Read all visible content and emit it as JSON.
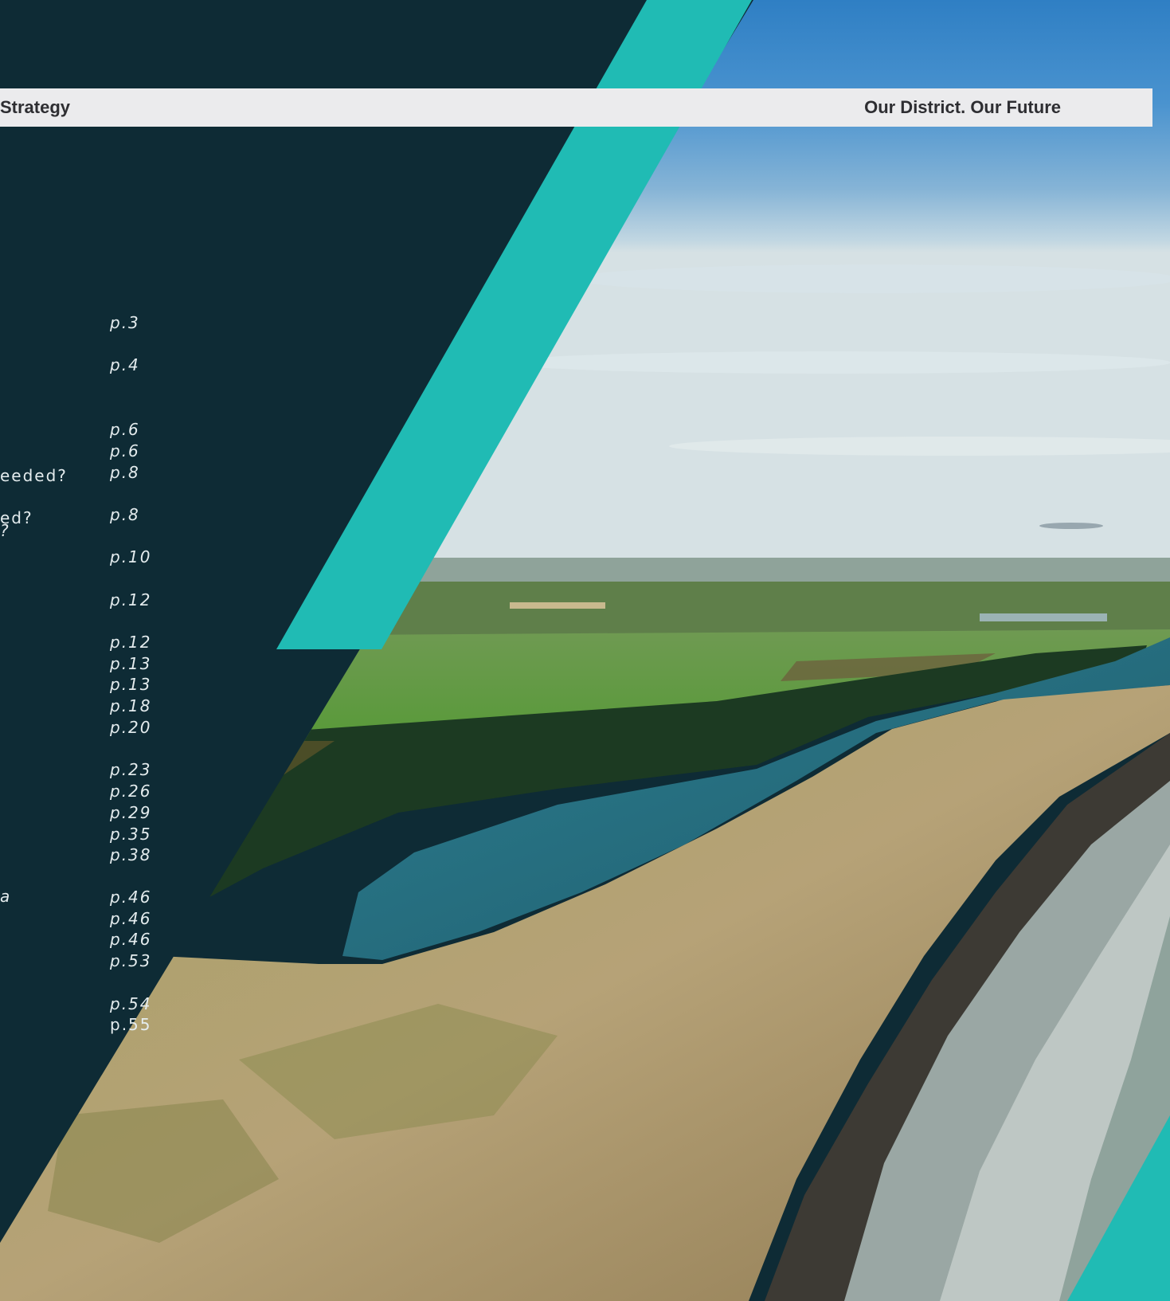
{
  "header": {
    "left_title": "Strategy",
    "right_title": "Our District. Our Future"
  },
  "colors": {
    "navy": "#0e2b35",
    "teal": "#20bbb4",
    "header_bg": "#ebebed",
    "header_text": "#2e2e32",
    "toc_text": "#e4ecee"
  },
  "toc": {
    "entries": [
      {
        "page": "p.3"
      },
      {
        "page": "p.4"
      },
      {
        "page": "p.6"
      },
      {
        "page": "p.6"
      },
      {
        "page": "p.8",
        "fragment": "eeded?"
      },
      {
        "page": "p.8",
        "fragment": "ed?",
        "fragment2": "?"
      },
      {
        "page": "p.10"
      },
      {
        "page": "p.12"
      },
      {
        "page": "p.12"
      },
      {
        "page": "p.13"
      },
      {
        "page": "p.13"
      },
      {
        "page": "p.18"
      },
      {
        "page": "p.20"
      },
      {
        "page": "p.23"
      },
      {
        "page": "p.26"
      },
      {
        "page": "p.29"
      },
      {
        "page": "p.35"
      },
      {
        "page": "p.38"
      },
      {
        "page": "p.46",
        "fragment": "a"
      },
      {
        "page": "p.46"
      },
      {
        "page": "p.46"
      },
      {
        "page": "p.53"
      },
      {
        "page": "p.54"
      },
      {
        "page": "p.55"
      }
    ]
  },
  "photo": {
    "subject": "aerial-coastline-photo"
  }
}
